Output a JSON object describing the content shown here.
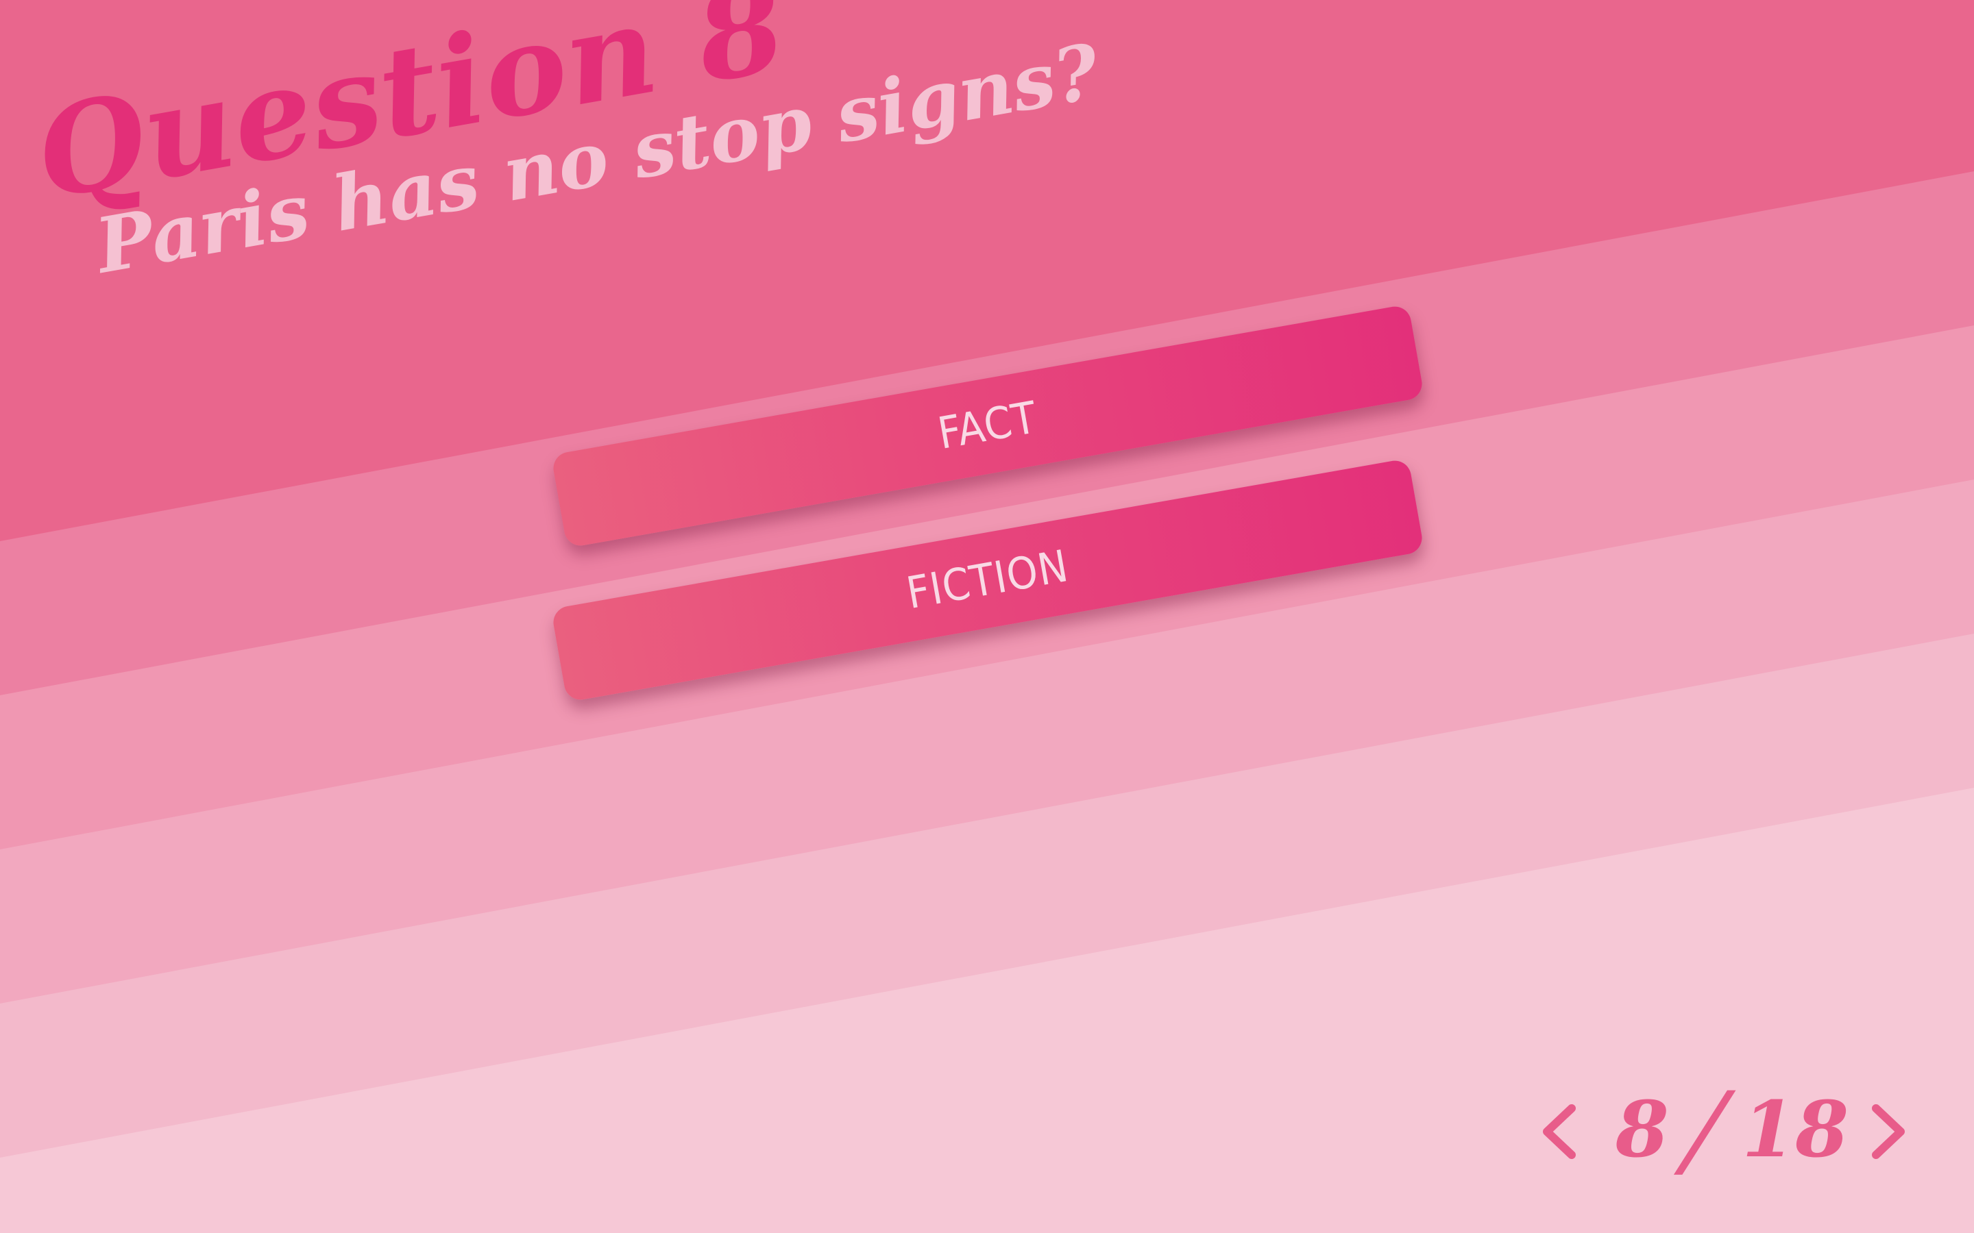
{
  "question": {
    "title": "Question 8",
    "text": "Paris has no stop signs?"
  },
  "answers": [
    {
      "label": "FACT"
    },
    {
      "label": "FICTION"
    }
  ],
  "pagination": {
    "current": "8",
    "separator": "/",
    "total": "18",
    "prev_icon": "chevron-left-icon",
    "next_icon": "chevron-right-icon"
  },
  "colors": {
    "accent": "#e32f78",
    "button_gradient_start": "#ea607f",
    "button_gradient_end": "#e3307a",
    "question_text": "#f5c1d2",
    "pager": "#e85c8a"
  }
}
